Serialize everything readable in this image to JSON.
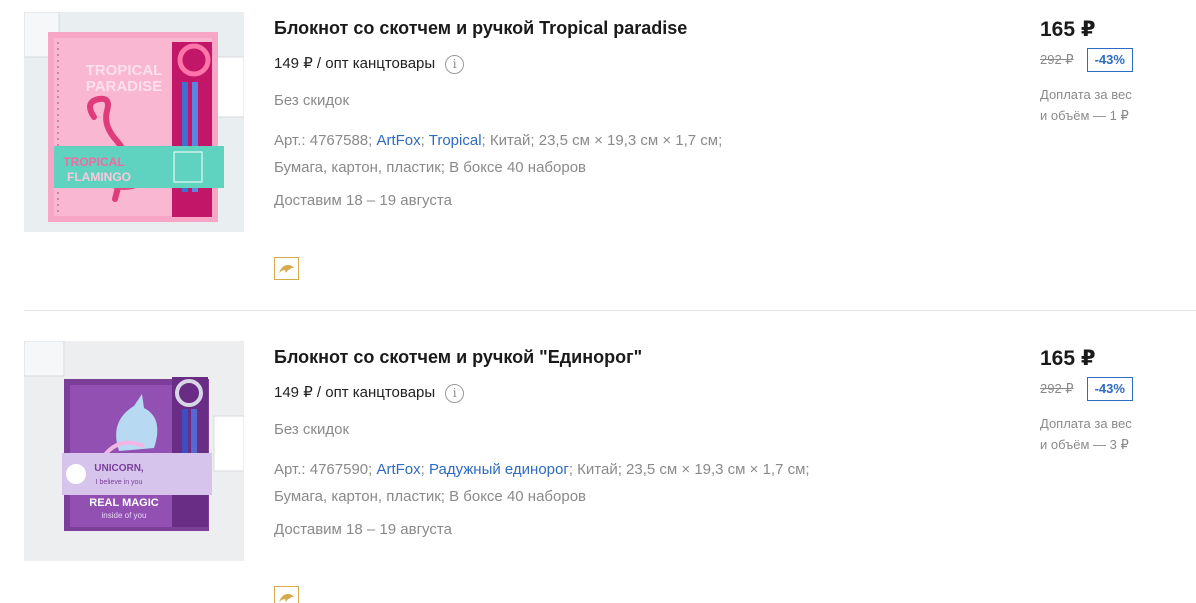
{
  "products": [
    {
      "title": "Блокнот со скотчем и ручкой Tropical paradise",
      "wholesale": "149 ₽ / опт канцтовары",
      "discount_note": "Без скидок",
      "art_label": "Арт.: 4767588;",
      "brand": "ArtFox",
      "series": "Tropical",
      "attrs_rest": "; Китай; 23,5 см × 19,3 см × 1,7 см;",
      "attrs_line2": "Бумага, картон, пластик; В боксе 40 наборов",
      "delivery": "Доставим 18 – 19 августа",
      "price": "165 ₽",
      "old_price": "292 ₽",
      "discount": "-43%",
      "surcharge_line1": "Доплата за вес",
      "surcharge_line2": "и объём — 1 ₽",
      "image_text_1": "TROPICAL",
      "image_text_2": "PARADISE",
      "image_text_3": "TROPICAL",
      "image_text_4": "FLAMINGO"
    },
    {
      "title": "Блокнот со скотчем и ручкой \"Единорог\"",
      "wholesale": "149 ₽ / опт канцтовары",
      "discount_note": "Без скидок",
      "art_label": "Арт.: 4767590;",
      "brand": "ArtFox",
      "series": "Радужный единорог",
      "attrs_rest": "; Китай; 23,5 см × 19,3 см × 1,7 см;",
      "attrs_line2": "Бумага, картон, пластик; В боксе 40 наборов",
      "delivery": "Доставим 18 – 19 августа",
      "price": "165 ₽",
      "old_price": "292 ₽",
      "discount": "-43%",
      "surcharge_line1": "Доплата за вес",
      "surcharge_line2": "и объём — 3 ₽",
      "image_text_1": "UNICORN,",
      "image_text_2": "I believe in you",
      "image_text_3": "REAL MAGIC",
      "image_text_4": "inside of you"
    }
  ],
  "colors": {
    "link": "#2e6bc2",
    "muted": "#8a8a8a",
    "badge_border": "#2e6bc2",
    "dolphin_border": "#d5aa4a"
  },
  "icons": [
    "info-icon",
    "dolphin-icon"
  ]
}
